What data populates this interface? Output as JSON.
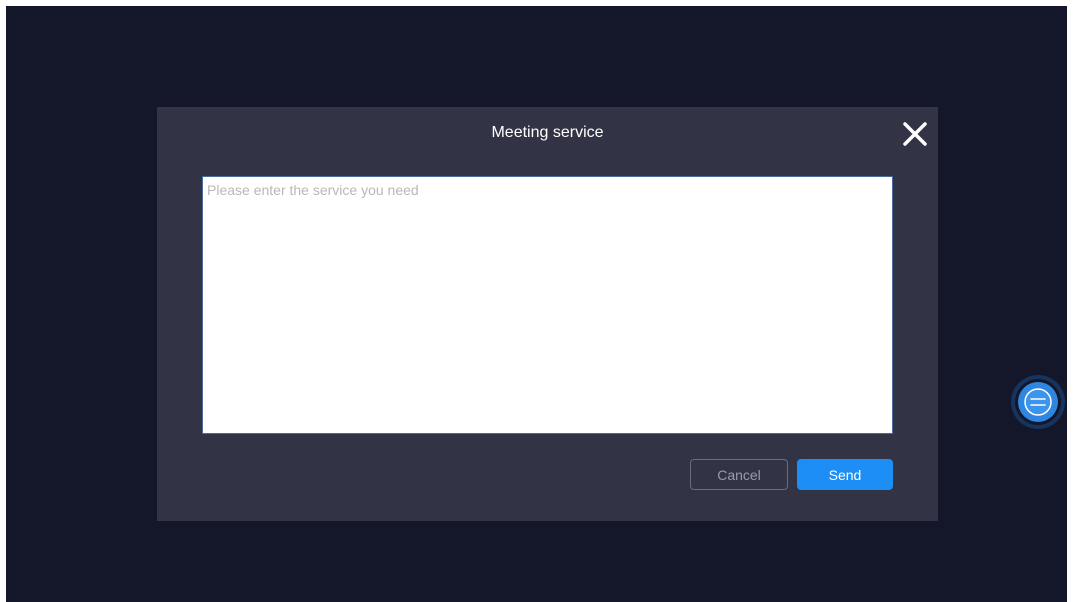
{
  "dialog": {
    "title": "Meeting service",
    "textarea_placeholder": "Please enter the service you need",
    "textarea_value": "",
    "cancel_label": "Cancel",
    "send_label": "Send",
    "close_icon": "close-icon"
  },
  "floating_button": {
    "icon": "menu-icon"
  },
  "colors": {
    "background": "#14162a",
    "dialog": "#323445",
    "accent": "#1d8ef5"
  }
}
